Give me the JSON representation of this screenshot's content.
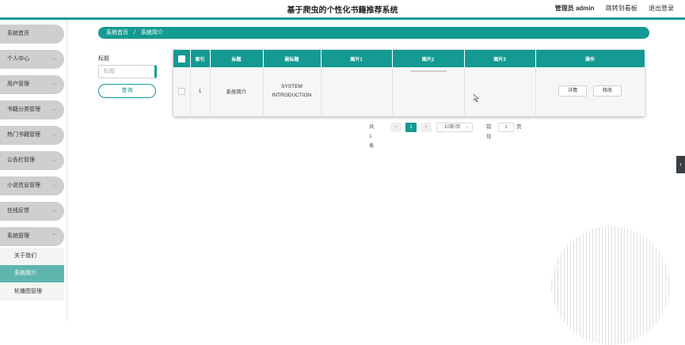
{
  "header": {
    "title": "基于爬虫的个性化书籍推荐系统",
    "admin_label": "管理员 admin",
    "dashboard_link": "跳转到看板",
    "logout_link": "退出登录"
  },
  "sidebar": {
    "items": [
      {
        "label": "系统首页"
      },
      {
        "label": "个人中心"
      },
      {
        "label": "用户管理"
      },
      {
        "label": "书籍分类管理"
      },
      {
        "label": "热门书籍管理"
      },
      {
        "label": "公告栏管理"
      },
      {
        "label": "小说信息管理"
      },
      {
        "label": "在线反馈"
      },
      {
        "label": "系统管理"
      }
    ],
    "sub_items": [
      {
        "label": "关于我们"
      },
      {
        "label": "系统简介"
      },
      {
        "label": "轮播图管理"
      }
    ]
  },
  "breadcrumb": {
    "home": "系统首页",
    "separator": "/",
    "current": "系统简介"
  },
  "search": {
    "label": "标题",
    "placeholder": "标题",
    "button": "查询"
  },
  "table": {
    "headers": [
      "索引",
      "标题",
      "副标题",
      "图片1",
      "图片2",
      "图片3",
      "操作"
    ],
    "rows": [
      {
        "index": "1",
        "title": "系统简介",
        "subtitle": "SYSTEM INTRODUCTION",
        "detail_button": "详情",
        "edit_button": "修改"
      }
    ]
  },
  "pagination": {
    "total": "共 1 条",
    "prev": "<",
    "current_page": "1",
    "next": ">",
    "page_size": "10条/页",
    "goto_label": "前往",
    "goto_value": "1",
    "page_unit": "页"
  },
  "colors": {
    "accent": "#149a92",
    "active_sub": "#5fb6ae",
    "menu_bg": "#cfcfcf"
  }
}
